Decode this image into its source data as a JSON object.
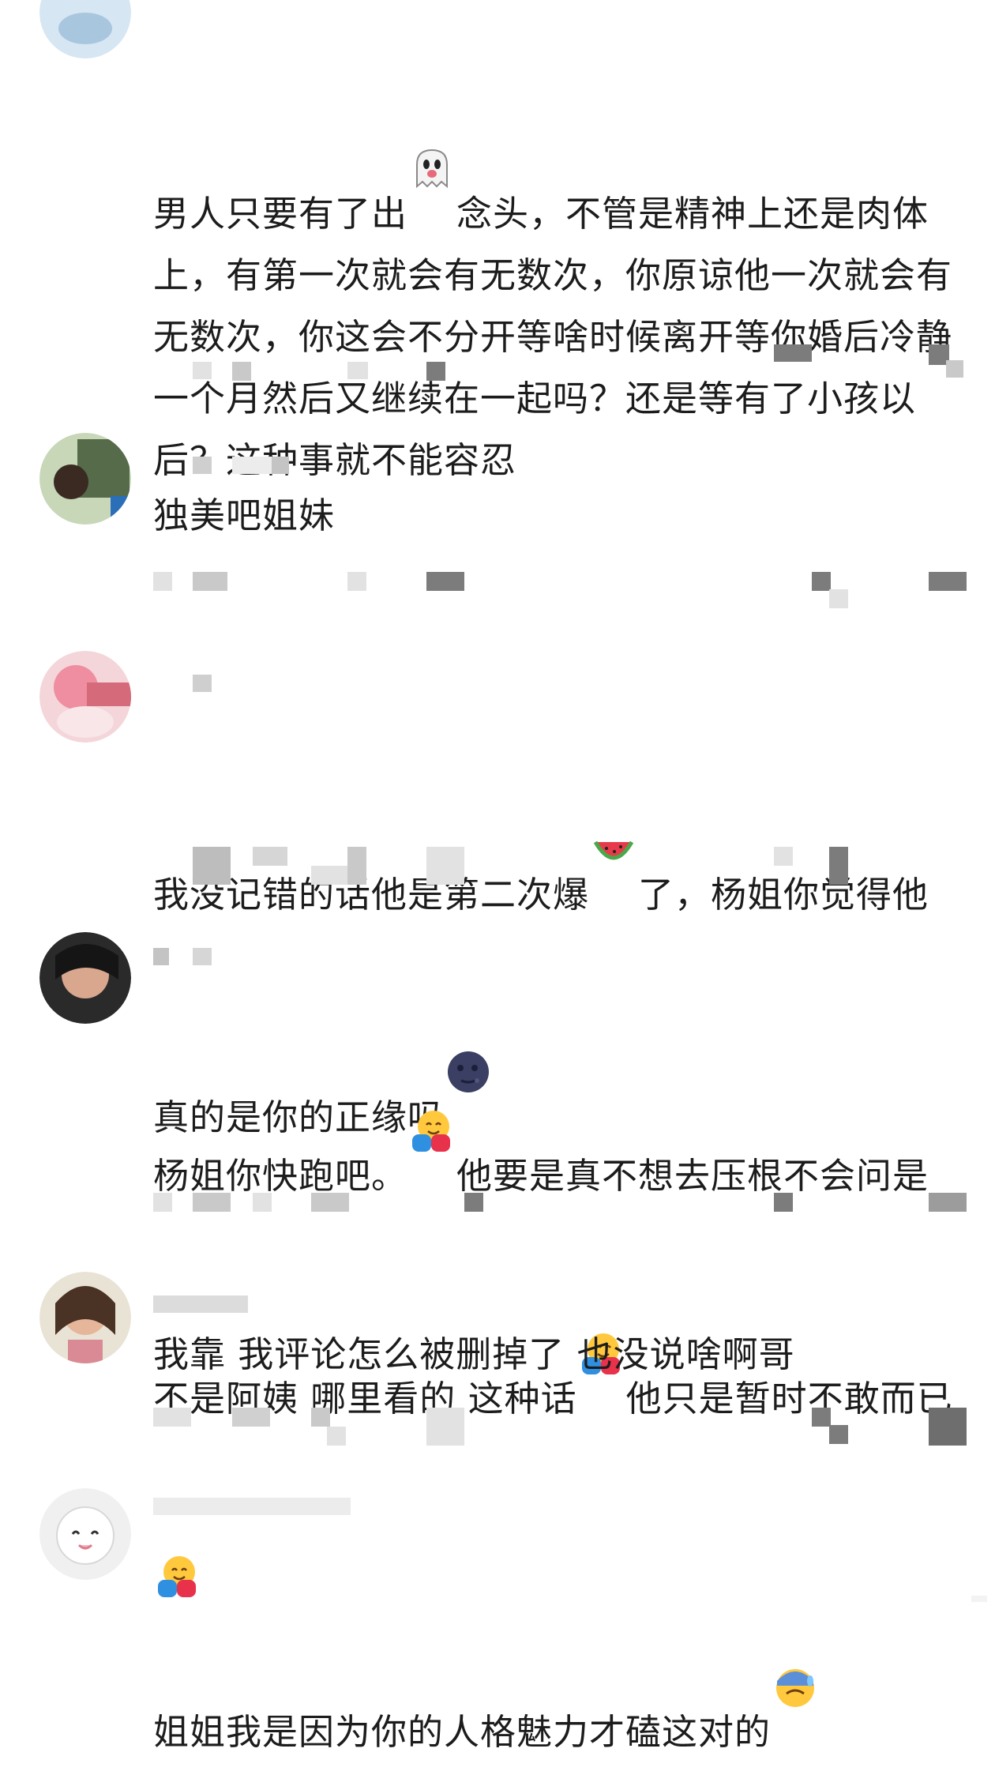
{
  "comments": [
    {
      "id": "c1",
      "username": "",
      "segments": [
        {
          "t": "男人只要有了出"
        },
        {
          "e": "ghost"
        },
        {
          "t": "念头，不管是精神上还是肉体上，有第一次就会有无数次，你原谅他一次就会有无数次，你这会不分开等啥时候离开等你婚后冷静一个月然后又继续在一起吗？还是等有了小孩以后？这种事就不能容忍"
        }
      ]
    },
    {
      "id": "c2",
      "username": "",
      "segments": [
        {
          "t": "独美吧姐妹"
        }
      ]
    },
    {
      "id": "c3",
      "username": "",
      "segments": [
        {
          "t": "我没记错的话他是第二次爆"
        },
        {
          "e": "watermelon"
        },
        {
          "t": "了，杨姐你觉得他真的是你的正缘吗"
        },
        {
          "e": "moon"
        }
      ]
    },
    {
      "id": "c4",
      "username": "",
      "segments": [
        {
          "t": "杨姐你快跑吧。"
        },
        {
          "e": "hug"
        },
        {
          "t": "他要是真不想去压根不会问是不是阿姨 哪里看的 这种话"
        },
        {
          "e": "hug"
        },
        {
          "t": "他只是暂时不敢而已"
        },
        {
          "e": "hug"
        }
      ]
    },
    {
      "id": "c5",
      "username": "",
      "segments": [
        {
          "t": "我靠 我评论怎么被删掉了 也没说啥啊哥"
        }
      ]
    },
    {
      "id": "c6",
      "username": "",
      "segments": [
        {
          "t": "姐姐我是因为你的人格魅力才磕这对的"
        },
        {
          "e": "sweat"
        }
      ]
    }
  ],
  "watermark": "",
  "icons": {
    "ghost": "ghost-emoji-icon",
    "watermelon": "watermelon-emoji-icon",
    "moon": "new-moon-face-emoji-icon",
    "hug": "hugging-face-emoji-icon",
    "sweat": "sweat-face-emoji-icon"
  }
}
